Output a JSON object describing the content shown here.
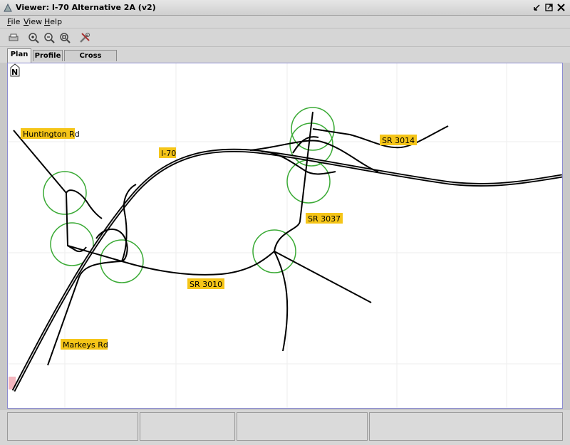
{
  "window": {
    "title": "Viewer: I-70 Alternative 2A (v2)"
  },
  "menu": {
    "file": "File",
    "view": "View",
    "help": "Help"
  },
  "toolbar": [
    "print-icon",
    "zoom-in-icon",
    "zoom-out-icon",
    "zoom-extent-icon",
    "tools-icon"
  ],
  "tabs": [
    {
      "label": "Plan",
      "active": true
    },
    {
      "label": "Profile",
      "active": false
    },
    {
      "label": "Cross Section",
      "active": false
    }
  ],
  "map": {
    "north_arrow": "N",
    "labels": {
      "huntington": "Huntington Rd",
      "i70": "I-70",
      "sr3014": "SR 3014",
      "sr3037": "SR 3037",
      "sr3010": "SR 3010",
      "markeys": "Markeys Rd"
    },
    "label_color": "#f5c518",
    "interchange_color": "#3aaa35"
  },
  "status": [
    "",
    "",
    "",
    ""
  ]
}
